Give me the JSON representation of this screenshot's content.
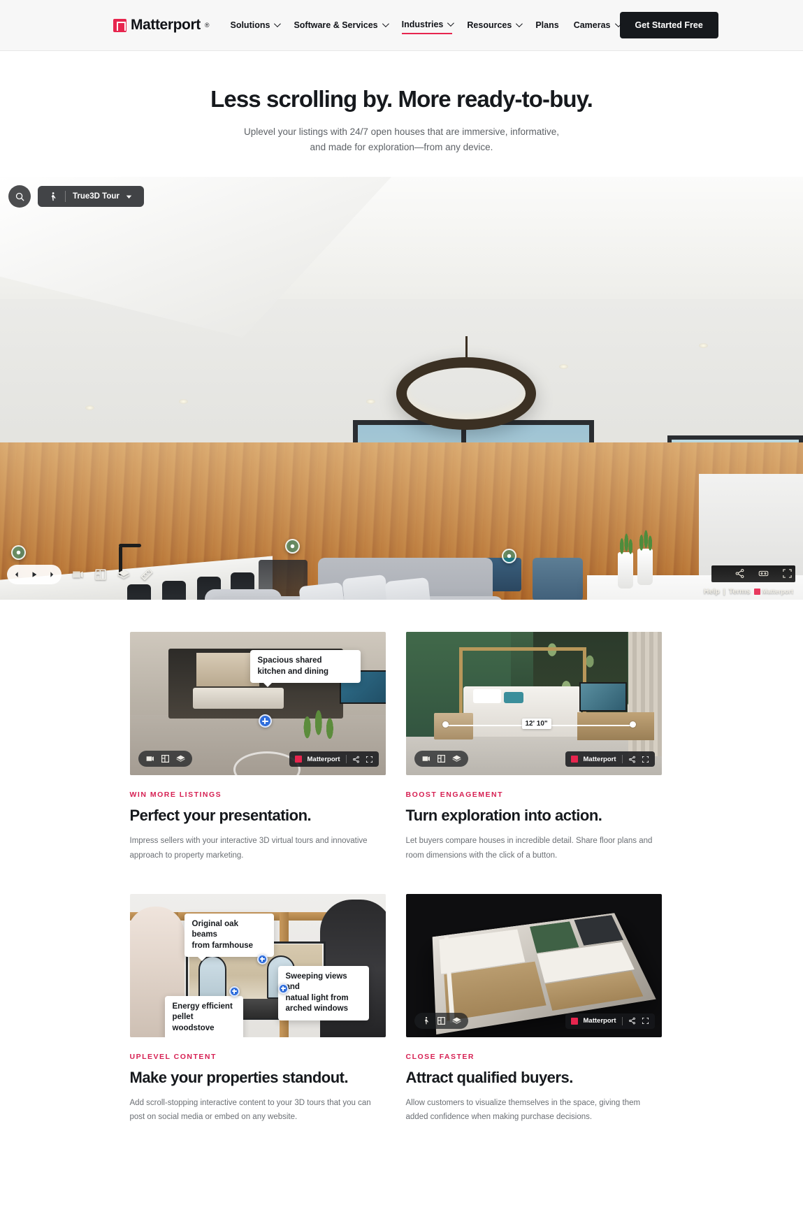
{
  "header": {
    "brand": "Matterport",
    "brand_reg": "®",
    "nav": [
      {
        "label": "Solutions",
        "has_caret": true,
        "active": false
      },
      {
        "label": "Software & Services",
        "has_caret": true,
        "active": false
      },
      {
        "label": "Industries",
        "has_caret": true,
        "active": true
      },
      {
        "label": "Resources",
        "has_caret": true,
        "active": false
      },
      {
        "label": "Plans",
        "has_caret": false,
        "active": false
      },
      {
        "label": "Cameras",
        "has_caret": true,
        "active": false
      }
    ],
    "cta": "Get Started Free",
    "accent_color": "#e7254e"
  },
  "hero": {
    "title": "Less scrolling by. More ready-to-buy.",
    "subtitle_line1": "Uplevel your listings with 24/7 open houses that are immersive, informative,",
    "subtitle_line2": "and made for exploration—from any device."
  },
  "viewer": {
    "search_icon": "search-icon",
    "mode_icon": "person-walk-icon",
    "mode_label": "True3D Tour",
    "mode_caret": "chevron-down-icon",
    "nav_prev": "chevron-left-icon",
    "nav_play": "play-icon",
    "nav_next": "chevron-right-icon",
    "tools": [
      "highlight-reel-icon",
      "floorplan-icon",
      "dollhouse-icon",
      "measure-icon"
    ],
    "share_icon": "share-icon",
    "vr_icon": "vr-goggles-icon",
    "fullscreen_icon": "fullscreen-icon",
    "legal_help": "Help",
    "legal_sep": "|",
    "legal_terms": "Terms",
    "legal_brand": "Matterport"
  },
  "cards": [
    {
      "kicker": "WIN MORE LISTINGS",
      "title": "Perfect your presentation.",
      "body": "Impress sellers with your interactive 3D virtual tours and innovative approach to property marketing.",
      "tooltip": "Spacious shared\nkitchen and dining",
      "badge_name": "Matterport",
      "toolbar_icons": [
        "highlight-reel-icon",
        "floorplan-icon",
        "dollhouse-icon"
      ],
      "badge_icons": [
        "share-icon",
        "fullscreen-icon"
      ]
    },
    {
      "kicker": "BOOST ENGAGEMENT",
      "title": "Turn exploration into action.",
      "body": "Let buyers compare houses in incredible detail. Share floor plans and room dimensions with the click of a button.",
      "measurement": "12' 10\"",
      "badge_name": "Matterport",
      "toolbar_icons": [
        "highlight-reel-icon",
        "floorplan-icon",
        "dollhouse-icon"
      ],
      "badge_icons": [
        "share-icon",
        "fullscreen-icon"
      ]
    },
    {
      "kicker": "UPLEVEL CONTENT",
      "title": "Make your properties standout.",
      "body": "Add scroll-stopping interactive content to your 3D tours that you can post on social media or embed on any website.",
      "tooltip_1": "Original oak beams\nfrom farmhouse",
      "tooltip_2": "Sweeping views and\nnatual light from\narched windows",
      "tooltip_3": "Energy efficient\npellet woodstove"
    },
    {
      "kicker": "CLOSE FASTER",
      "title": "Attract qualified buyers.",
      "body": "Allow customers to visualize themselves in the space, giving them added confidence when making purchase decisions.",
      "badge_name": "Matterport",
      "toolbar_icons": [
        "person-walk-icon",
        "floorplan-icon",
        "dollhouse-icon"
      ],
      "badge_icons": [
        "share-icon",
        "fullscreen-icon"
      ]
    }
  ]
}
